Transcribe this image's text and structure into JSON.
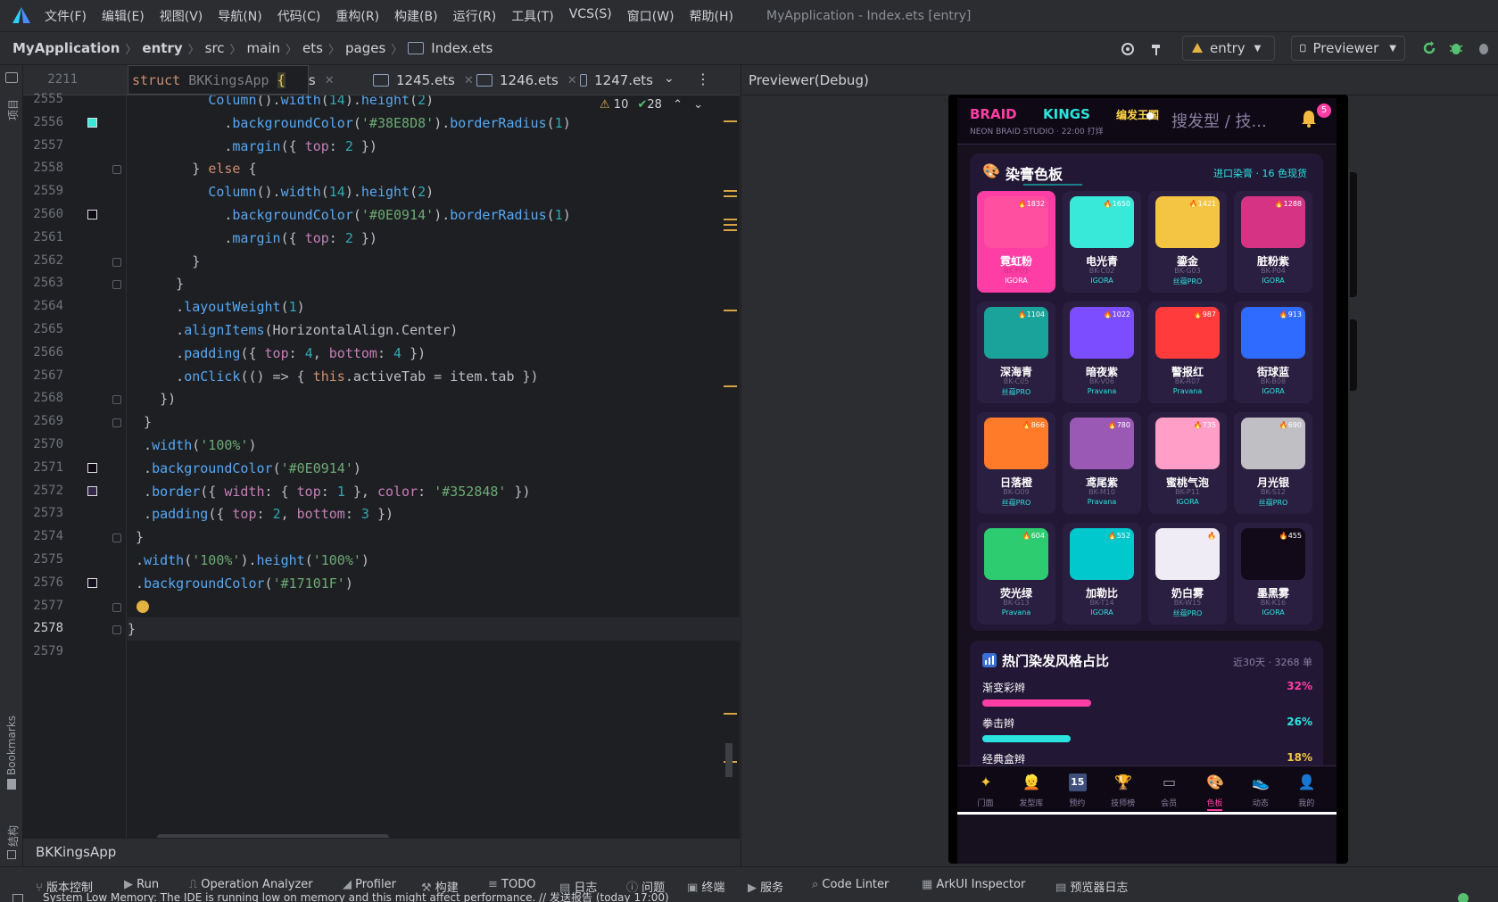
{
  "menubar": {
    "items": [
      "文件(F)",
      "编辑(E)",
      "视图(V)",
      "导航(N)",
      "代码(C)",
      "重构(R)",
      "构建(B)",
      "运行(R)",
      "工具(T)",
      "VCS(S)",
      "窗口(W)",
      "帮助(H)"
    ],
    "window_title": "MyApplication - Index.ets [entry]"
  },
  "breadcrumb": [
    "MyApplication",
    "entry",
    "src",
    "main",
    "ets",
    "pages",
    "Index.ets"
  ],
  "toolbar": {
    "module_select": "entry",
    "device_select": "Previewer"
  },
  "left_strip": {
    "project": "项目",
    "bookmarks": "Bookmarks",
    "structure": "结构"
  },
  "editor": {
    "tabs": [
      ".ets",
      "1245.ets",
      "1246.ets",
      "1247.ets"
    ],
    "sticky_line_number": "2211",
    "sticky_header": "struct BKKingsApp {",
    "warnings": "10",
    "checks": "28",
    "line_numbers": [
      "2555",
      "2556",
      "2557",
      "2558",
      "2559",
      "2560",
      "2561",
      "2562",
      "2563",
      "2564",
      "2565",
      "2566",
      "2567",
      "2568",
      "2569",
      "2570",
      "2571",
      "2572",
      "2573",
      "2574",
      "2575",
      "2576",
      "2577",
      "2578",
      "2579"
    ],
    "code_lines": [
      "          Column().width(14).height(2)",
      "            .backgroundColor('#38E8D8').borderRadius(1)",
      "            .margin({ top: 2 })",
      "        } else {",
      "          Column().width(14).height(2)",
      "            .backgroundColor('#0E0914').borderRadius(1)",
      "            .margin({ top: 2 })",
      "        }",
      "      }",
      "      .layoutWeight(1)",
      "      .alignItems(HorizontalAlign.Center)",
      "      .padding({ top: 4, bottom: 4 })",
      "      .onClick(() => { this.activeTab = item.tab })",
      "    })",
      "  }",
      "  .width('100%')",
      "  .backgroundColor('#0E0914')",
      "  .border({ width: { top: 1 }, color: '#352848' })",
      "  .padding({ top: 2, bottom: 3 })",
      " }",
      " .width('100%').height('100%')",
      " .backgroundColor('#17101F')",
      "",
      "}",
      ""
    ],
    "swatch_colors": {
      "2556": "#38E8D8",
      "2560": "#0E0914",
      "2571": "#0E0914",
      "2572": "#352848",
      "2576": "#17101F"
    },
    "footer_struct": "BKKingsApp"
  },
  "preview": {
    "title": "Previewer(Debug)",
    "app": {
      "brand_a": "BRAID",
      "brand_b": "KINGS",
      "brand_cn": "编发王国",
      "subtitle": "NEON BRAID STUDIO · 22:00 打烊",
      "search_placeholder": "搜发型 / 技...",
      "notif_count": "5",
      "palette_title": "染膏色板",
      "palette_tag": "进口染膏 · 16 色现货",
      "colors": [
        {
          "name": "霓虹粉",
          "code": "BK-P01",
          "brand": "IGORA",
          "count": "1832",
          "hex": "#ff4fa0",
          "active": true
        },
        {
          "name": "电光青",
          "code": "BK-C02",
          "brand": "IGORA",
          "count": "1650",
          "hex": "#38e8d8"
        },
        {
          "name": "鎏金",
          "code": "BK-G03",
          "brand": "丝蕴PRO",
          "count": "1421",
          "hex": "#f4c542"
        },
        {
          "name": "脏粉紫",
          "code": "BK-P04",
          "brand": "IGORA",
          "count": "1288",
          "hex": "#d63384"
        },
        {
          "name": "深海青",
          "code": "BK-C05",
          "brand": "丝蕴PRO",
          "count": "1104",
          "hex": "#1aa39a"
        },
        {
          "name": "暗夜紫",
          "code": "BK-V06",
          "brand": "Pravana",
          "count": "1022",
          "hex": "#7b4dff"
        },
        {
          "name": "警报红",
          "code": "BK-R07",
          "brand": "Pravana",
          "count": "987",
          "hex": "#ff3b3b"
        },
        {
          "name": "街球蓝",
          "code": "BK-B08",
          "brand": "IGORA",
          "count": "913",
          "hex": "#2f6bff"
        },
        {
          "name": "日落橙",
          "code": "BK-O09",
          "brand": "丝蕴PRO",
          "count": "866",
          "hex": "#ff7a29"
        },
        {
          "name": "鸢尾紫",
          "code": "BK-M10",
          "brand": "Pravana",
          "count": "780",
          "hex": "#9b59b6"
        },
        {
          "name": "蜜桃气泡",
          "code": "BK-P11",
          "brand": "IGORA",
          "count": "735",
          "hex": "#ff9fc8"
        },
        {
          "name": "月光银",
          "code": "BK-S12",
          "brand": "丝蕴PRO",
          "count": "690",
          "hex": "#c0c0c4"
        },
        {
          "name": "荧光绿",
          "code": "BK-G13",
          "brand": "Pravana",
          "count": "604",
          "hex": "#2ecc71"
        },
        {
          "name": "加勒比",
          "code": "BK-T14",
          "brand": "IGORA",
          "count": "552",
          "hex": "#00c8cc"
        },
        {
          "name": "奶白雾",
          "code": "BK-W15",
          "brand": "丝蕴PRO",
          "count": "",
          "hex": "#f0ecf5"
        },
        {
          "name": "墨黑雾",
          "code": "BK-K16",
          "brand": "IGORA",
          "count": "455",
          "hex": "#120a18"
        }
      ],
      "styles_title": "热门染发风格占比",
      "styles_meta": "近30天 · 3268 单",
      "styles": [
        {
          "name": "渐变彩辫",
          "pct": "32%",
          "value": 0.32,
          "color": "#ff3ea5"
        },
        {
          "name": "拳击辫",
          "pct": "26%",
          "value": 0.26,
          "color": "#2be4e0"
        },
        {
          "name": "经典盒辫",
          "pct": "18%",
          "value": 0.18,
          "color": "#f4c542"
        }
      ],
      "nav": [
        "门面",
        "发型库",
        "预约",
        "技师榜",
        "会员",
        "色板",
        "动态",
        "我的"
      ],
      "nav_icons": [
        "sparkle-icon",
        "hair-icon",
        "calendar-icon",
        "trophy-icon",
        "card-icon",
        "palette-icon",
        "sneaker-icon",
        "user-icon"
      ],
      "nav_calendar_day": "15",
      "nav_active": "色板"
    }
  },
  "bottom_tools": [
    "版本控制",
    "Run",
    "Operation Analyzer",
    "Profiler",
    "构建",
    "TODO",
    "日志",
    "问题",
    "终端",
    "服务",
    "Code Linter",
    "ArkUI Inspector",
    "预览器日志"
  ],
  "status": "System Low Memory: The IDE is running low on memory and this might affect performance. // 发送报告 (today 17:00)"
}
